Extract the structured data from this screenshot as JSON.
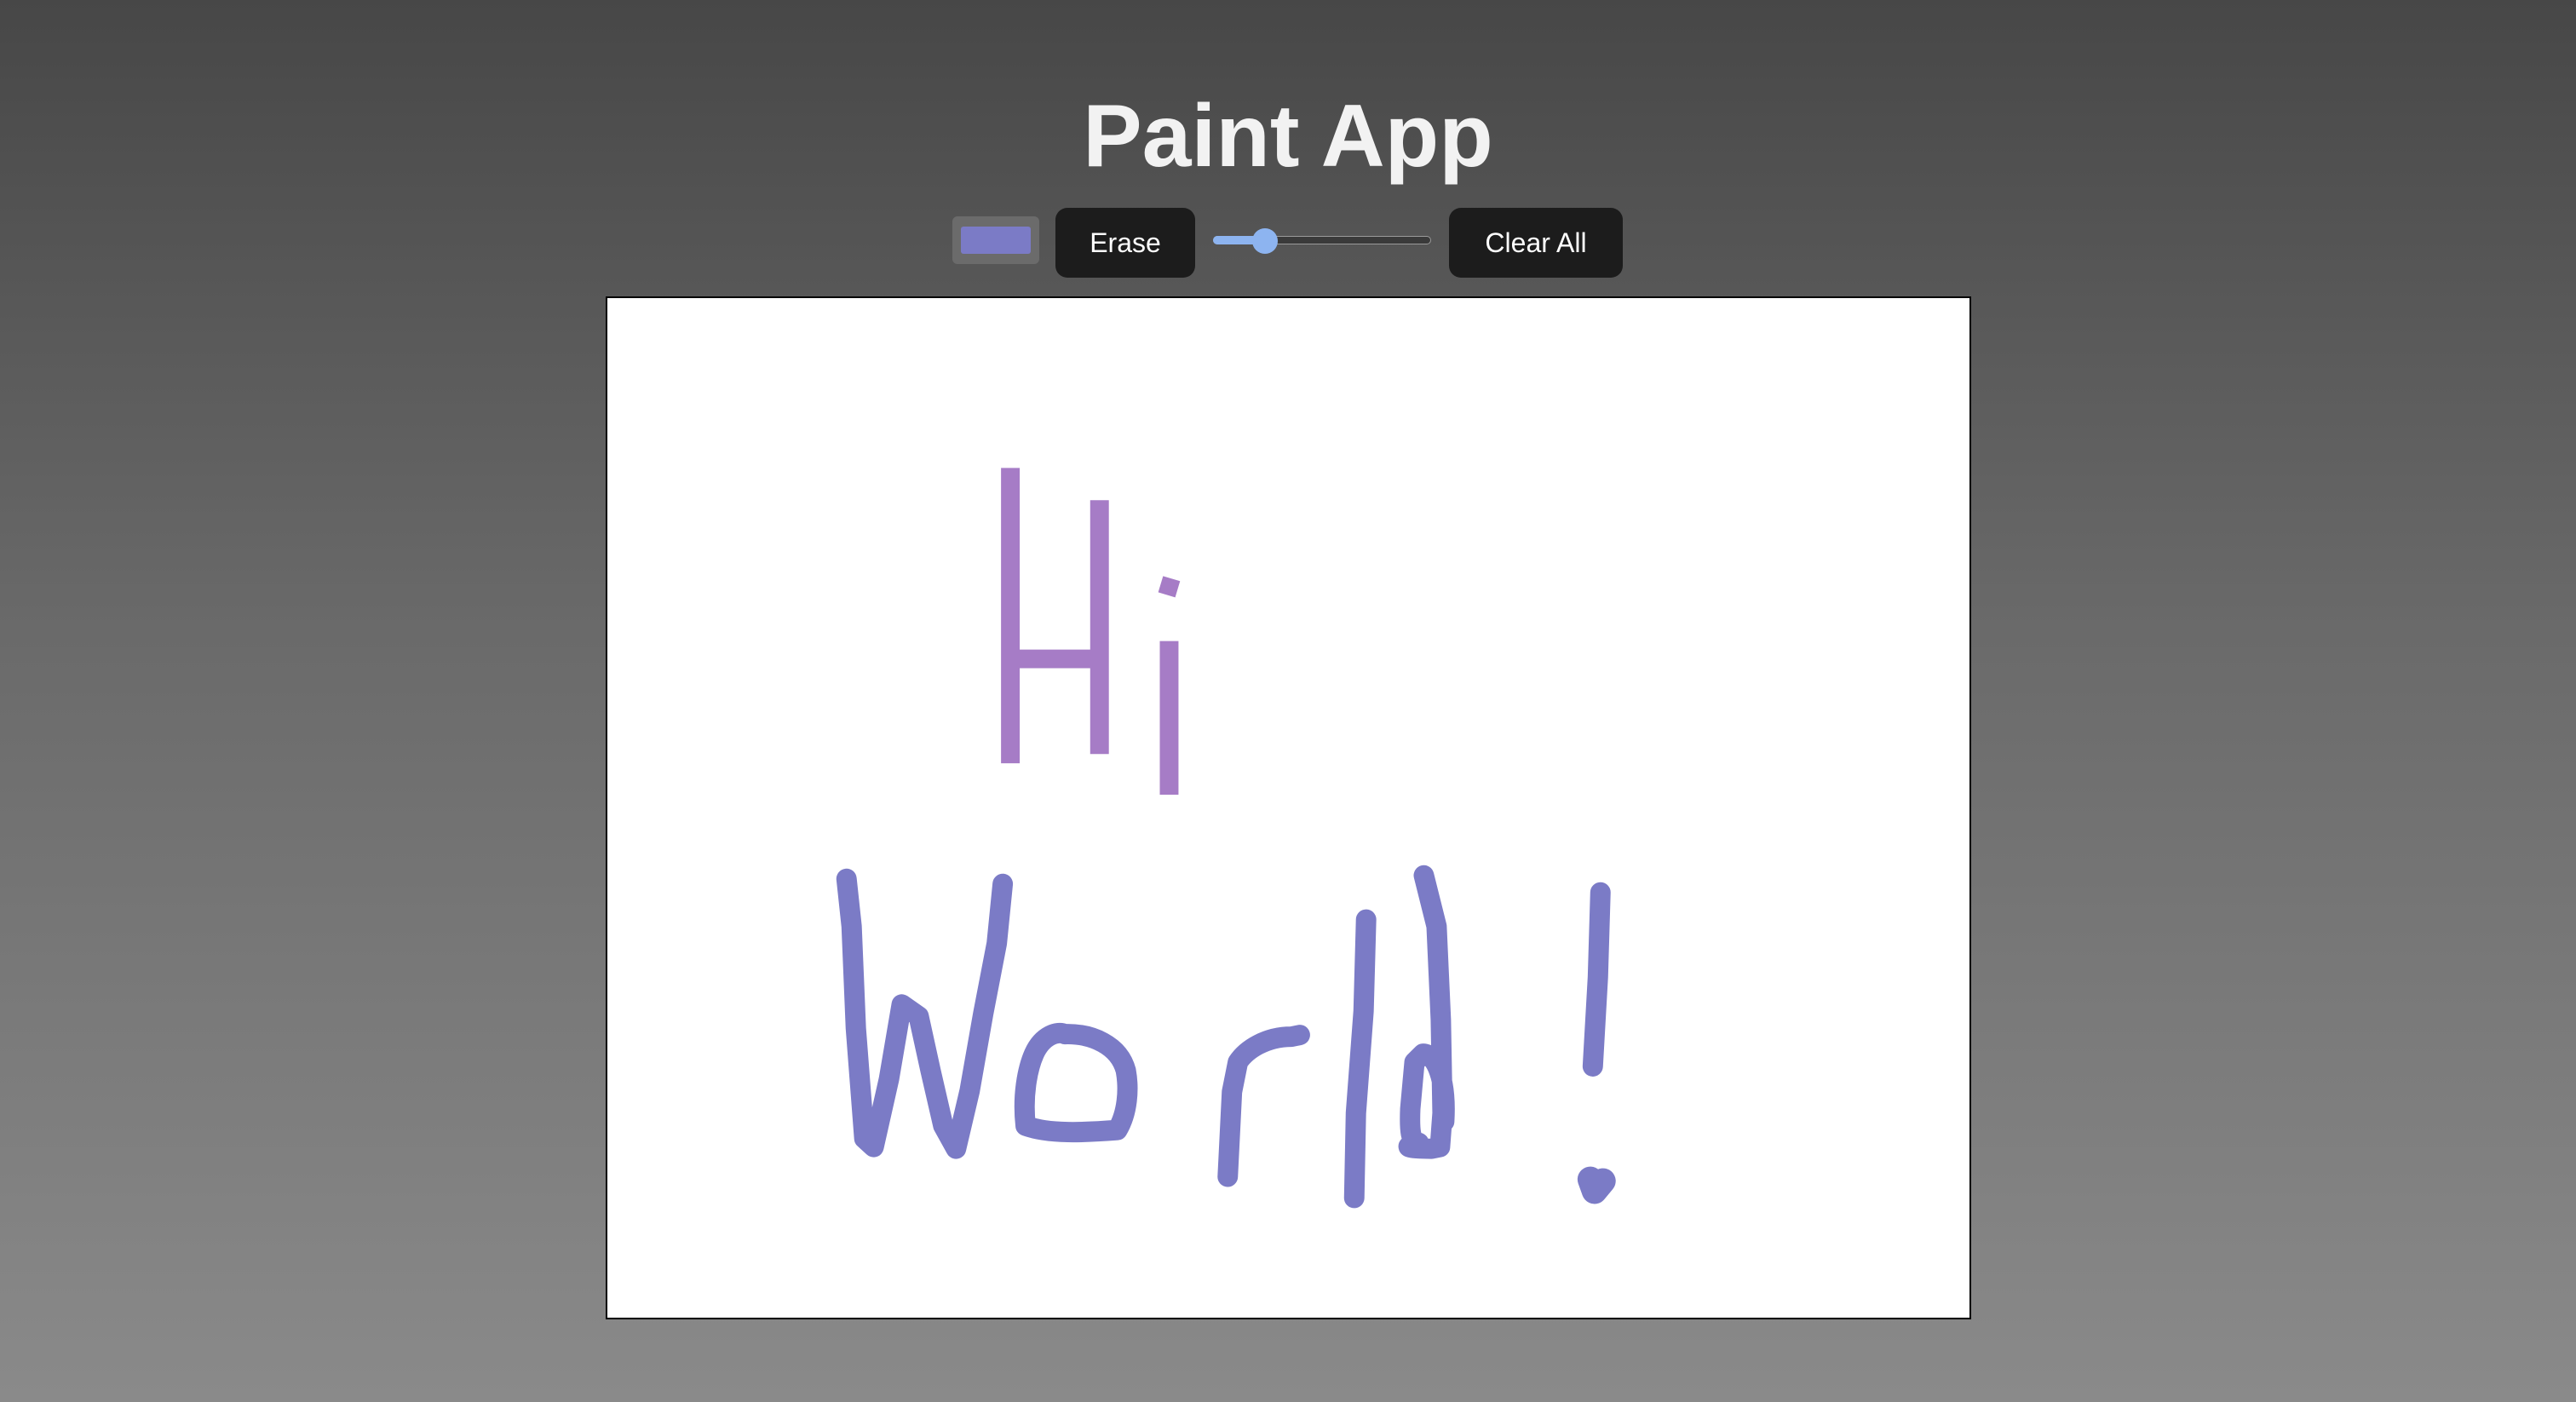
{
  "app": {
    "title": "Paint App"
  },
  "toolbar": {
    "color_value": "#7b7bc6",
    "erase_label": "Erase",
    "brush_size_fraction": 0.24,
    "clear_label": "Clear All"
  },
  "canvas": {
    "background": "#ffffff",
    "strokes": [
      {
        "word": "Hi",
        "color": "#a67cc6"
      },
      {
        "word": "World!",
        "color": "#7b7bc6"
      }
    ]
  },
  "colors": {
    "accent": "#8db4f0",
    "button_bg": "#1c1c1c"
  }
}
